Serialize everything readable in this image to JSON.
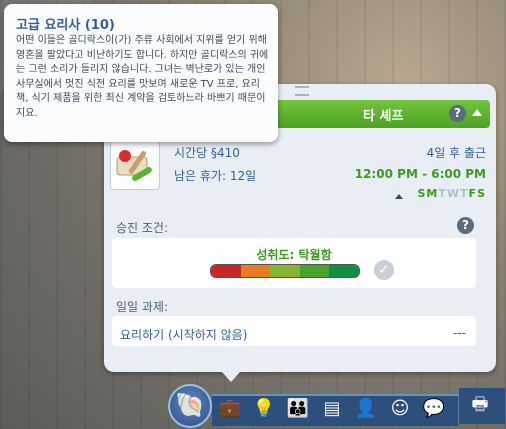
{
  "tooltip": {
    "title": "고급 요리사 (10)",
    "body": "어떤 이들은 골디락스이(가) 주류 사회에서 지위를 얻기 위해 영혼을 팔았다고 비난하기도 합니다. 하지만 골디락스의 귀에는 그런 소리가 들리지 않습니다. 그녀는 벽난로가 있는 개인 사무실에서 멋진 식전 요리를 맛보며 새로운 TV 프로, 요리책, 식기 제품을 위한 최신 계약을 검토하느라 바쁘기 때문이지요."
  },
  "career": {
    "header_title": "타 셰프",
    "help_glyph": "?",
    "pay_prefix": "시간당",
    "pay_value": "§410",
    "vacation": "남은 휴가: 12일",
    "next_shift": "4일 후 출근",
    "work_hours": "12:00 PM - 6:00 PM",
    "days": [
      {
        "letter": "S",
        "on": true
      },
      {
        "letter": "M",
        "on": true
      },
      {
        "letter": "T",
        "on": false
      },
      {
        "letter": "W",
        "on": false
      },
      {
        "letter": "T",
        "on": false
      },
      {
        "letter": "F",
        "on": true
      },
      {
        "letter": "S",
        "on": true
      }
    ],
    "today_index": 1
  },
  "promotion": {
    "section_label": "승진 조건:",
    "performance_label": "성취도: 탁월함",
    "performance_level": 0.88,
    "bar_colors": [
      "#c7272b",
      "#e77d20",
      "#86b42f",
      "#4aa32e",
      "#0f8f3f"
    ],
    "check_glyph": "✓"
  },
  "tasks": {
    "section_label": "일일 과제:",
    "items": [
      {
        "label": "요리하기 (시작하지 않음)",
        "progress": "---"
      }
    ]
  },
  "bottom_bar": {
    "career_glyph": "🐚",
    "icons": [
      {
        "name": "briefcase-icon",
        "glyph": "💼"
      },
      {
        "name": "lightbulb-icon",
        "glyph": "💡"
      },
      {
        "name": "relationships-icon",
        "glyph": "👪"
      },
      {
        "name": "inventory-icon",
        "glyph": "▤"
      },
      {
        "name": "sim-profile-icon",
        "glyph": "👤"
      },
      {
        "name": "aspiration-icon",
        "glyph": "☺"
      },
      {
        "name": "chat-icon",
        "glyph": "💬"
      },
      {
        "name": "register-icon",
        "glyph": "🖶"
      }
    ]
  }
}
